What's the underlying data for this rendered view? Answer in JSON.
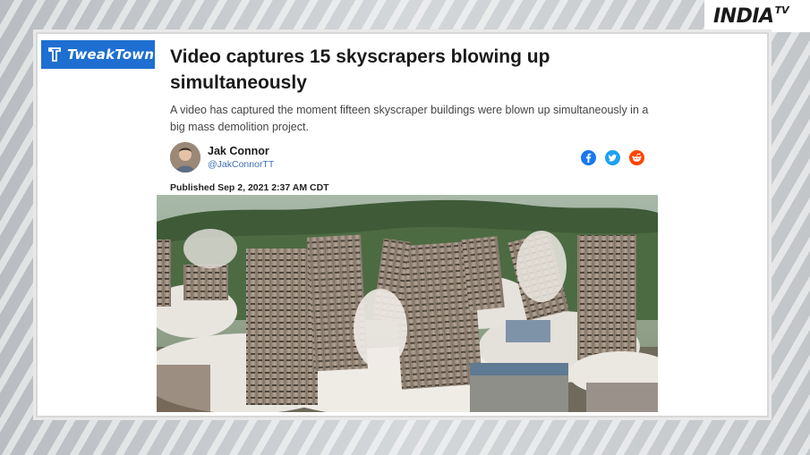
{
  "watermark": {
    "brand_main": "INDIA",
    "brand_sub": "TV"
  },
  "site": {
    "logo_text": "TweakTown"
  },
  "article": {
    "headline": "Video captures 15 skyscrapers blowing up simultaneously",
    "summary": "A video has captured the moment fifteen skyscraper buildings were blown up simultaneously in a big mass demolition project.",
    "author_name": "Jak Connor",
    "author_handle": "@JakConnorTT",
    "published": "Published Sep 2, 2021 2:37 AM CDT"
  },
  "share_buttons": [
    {
      "icon": "facebook-icon",
      "color": "#1877f2"
    },
    {
      "icon": "twitter-icon",
      "color": "#1da1f2"
    },
    {
      "icon": "reddit-icon",
      "color": "#ff4500"
    }
  ],
  "colors": {
    "logo_bg": "#1e6fd1",
    "handle": "#3b6fb6"
  }
}
